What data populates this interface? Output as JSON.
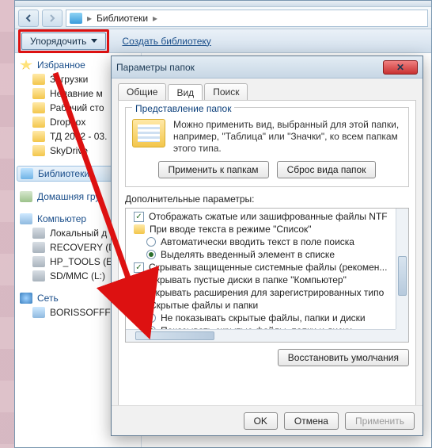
{
  "breadcrumb": {
    "location": "Библиотеки"
  },
  "toolbar": {
    "organize_label": "Упорядочить",
    "create_library_label": "Создать библиотеку"
  },
  "nav": {
    "favorites": {
      "head": "Избранное",
      "items": [
        "Загрузки",
        "Недавние м",
        "Рабочий сто",
        "Dropbox",
        "ТД 2012 - 03.",
        "SkyDrive"
      ]
    },
    "libraries": {
      "head": "Библиотеки"
    },
    "homegroup": {
      "head": "Домашняя гру"
    },
    "computer": {
      "head": "Компьютер",
      "items": [
        "Локальный д",
        "RECOVERY (D",
        "HP_TOOLS (E",
        "SD/MMC (L:)"
      ]
    },
    "network": {
      "head": "Сеть",
      "items": [
        "BORISSOFFF-"
      ]
    }
  },
  "dialog": {
    "title": "Параметры папок",
    "close_glyph": "✕",
    "tabs": {
      "general": "Общие",
      "view": "Вид",
      "search": "Поиск"
    },
    "group": {
      "title": "Представление папок",
      "text": "Можно применить вид, выбранный для этой папки, например, \"Таблица\" или \"Значки\", ко всем папкам этого типа.",
      "apply_btn": "Применить к папкам",
      "reset_btn": "Сброс вида папок"
    },
    "advanced_label": "Дополнительные параметры:",
    "tree": {
      "r1": {
        "checked": true,
        "text": "Отображать сжатые или зашифрованные файлы NTF"
      },
      "r2": {
        "text": "При вводе текста в режиме \"Список\""
      },
      "r2a": {
        "on": false,
        "text": "Автоматически вводить текст в поле поиска"
      },
      "r2b": {
        "on": true,
        "text": "Выделять введенный элемент в списке"
      },
      "r3": {
        "checked": true,
        "text": "Скрывать защищенные системные файлы (рекомен..."
      },
      "r4": {
        "checked": true,
        "text": "Скрывать пустые диски в папке \"Компьютер\""
      },
      "r5": {
        "checked": false,
        "text": "Скрывать расширения для зарегистрированных типо"
      },
      "r6": {
        "text": "Скрытые файлы и папки"
      },
      "r6a": {
        "on": false,
        "text": "Не показывать скрытые файлы, папки и диски"
      },
      "r6b": {
        "on": true,
        "text": "Показывать скрытые файлы, папки и диски"
      }
    },
    "restore_btn": "Восстановить умолчания",
    "ok_btn": "OK",
    "cancel_btn": "Отмена",
    "apply_btn": "Применить"
  }
}
